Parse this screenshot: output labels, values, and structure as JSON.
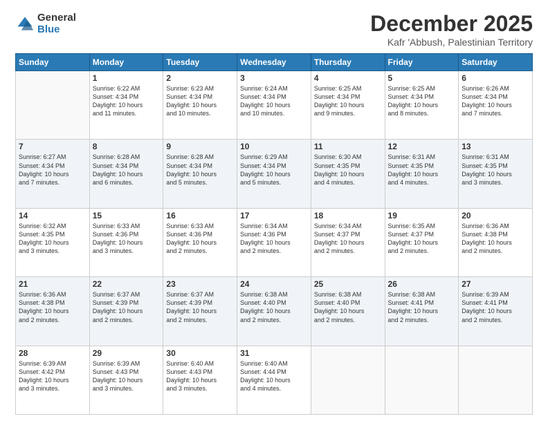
{
  "logo": {
    "general": "General",
    "blue": "Blue"
  },
  "header": {
    "month": "December 2025",
    "location": "Kafr 'Abbush, Palestinian Territory"
  },
  "days_of_week": [
    "Sunday",
    "Monday",
    "Tuesday",
    "Wednesday",
    "Thursday",
    "Friday",
    "Saturday"
  ],
  "weeks": [
    [
      {
        "num": "",
        "info": ""
      },
      {
        "num": "1",
        "info": "Sunrise: 6:22 AM\nSunset: 4:34 PM\nDaylight: 10 hours\nand 11 minutes."
      },
      {
        "num": "2",
        "info": "Sunrise: 6:23 AM\nSunset: 4:34 PM\nDaylight: 10 hours\nand 10 minutes."
      },
      {
        "num": "3",
        "info": "Sunrise: 6:24 AM\nSunset: 4:34 PM\nDaylight: 10 hours\nand 10 minutes."
      },
      {
        "num": "4",
        "info": "Sunrise: 6:25 AM\nSunset: 4:34 PM\nDaylight: 10 hours\nand 9 minutes."
      },
      {
        "num": "5",
        "info": "Sunrise: 6:25 AM\nSunset: 4:34 PM\nDaylight: 10 hours\nand 8 minutes."
      },
      {
        "num": "6",
        "info": "Sunrise: 6:26 AM\nSunset: 4:34 PM\nDaylight: 10 hours\nand 7 minutes."
      }
    ],
    [
      {
        "num": "7",
        "info": "Sunrise: 6:27 AM\nSunset: 4:34 PM\nDaylight: 10 hours\nand 7 minutes."
      },
      {
        "num": "8",
        "info": "Sunrise: 6:28 AM\nSunset: 4:34 PM\nDaylight: 10 hours\nand 6 minutes."
      },
      {
        "num": "9",
        "info": "Sunrise: 6:28 AM\nSunset: 4:34 PM\nDaylight: 10 hours\nand 5 minutes."
      },
      {
        "num": "10",
        "info": "Sunrise: 6:29 AM\nSunset: 4:34 PM\nDaylight: 10 hours\nand 5 minutes."
      },
      {
        "num": "11",
        "info": "Sunrise: 6:30 AM\nSunset: 4:35 PM\nDaylight: 10 hours\nand 4 minutes."
      },
      {
        "num": "12",
        "info": "Sunrise: 6:31 AM\nSunset: 4:35 PM\nDaylight: 10 hours\nand 4 minutes."
      },
      {
        "num": "13",
        "info": "Sunrise: 6:31 AM\nSunset: 4:35 PM\nDaylight: 10 hours\nand 3 minutes."
      }
    ],
    [
      {
        "num": "14",
        "info": "Sunrise: 6:32 AM\nSunset: 4:35 PM\nDaylight: 10 hours\nand 3 minutes."
      },
      {
        "num": "15",
        "info": "Sunrise: 6:33 AM\nSunset: 4:36 PM\nDaylight: 10 hours\nand 3 minutes."
      },
      {
        "num": "16",
        "info": "Sunrise: 6:33 AM\nSunset: 4:36 PM\nDaylight: 10 hours\nand 2 minutes."
      },
      {
        "num": "17",
        "info": "Sunrise: 6:34 AM\nSunset: 4:36 PM\nDaylight: 10 hours\nand 2 minutes."
      },
      {
        "num": "18",
        "info": "Sunrise: 6:34 AM\nSunset: 4:37 PM\nDaylight: 10 hours\nand 2 minutes."
      },
      {
        "num": "19",
        "info": "Sunrise: 6:35 AM\nSunset: 4:37 PM\nDaylight: 10 hours\nand 2 minutes."
      },
      {
        "num": "20",
        "info": "Sunrise: 6:36 AM\nSunset: 4:38 PM\nDaylight: 10 hours\nand 2 minutes."
      }
    ],
    [
      {
        "num": "21",
        "info": "Sunrise: 6:36 AM\nSunset: 4:38 PM\nDaylight: 10 hours\nand 2 minutes."
      },
      {
        "num": "22",
        "info": "Sunrise: 6:37 AM\nSunset: 4:39 PM\nDaylight: 10 hours\nand 2 minutes."
      },
      {
        "num": "23",
        "info": "Sunrise: 6:37 AM\nSunset: 4:39 PM\nDaylight: 10 hours\nand 2 minutes."
      },
      {
        "num": "24",
        "info": "Sunrise: 6:38 AM\nSunset: 4:40 PM\nDaylight: 10 hours\nand 2 minutes."
      },
      {
        "num": "25",
        "info": "Sunrise: 6:38 AM\nSunset: 4:40 PM\nDaylight: 10 hours\nand 2 minutes."
      },
      {
        "num": "26",
        "info": "Sunrise: 6:38 AM\nSunset: 4:41 PM\nDaylight: 10 hours\nand 2 minutes."
      },
      {
        "num": "27",
        "info": "Sunrise: 6:39 AM\nSunset: 4:41 PM\nDaylight: 10 hours\nand 2 minutes."
      }
    ],
    [
      {
        "num": "28",
        "info": "Sunrise: 6:39 AM\nSunset: 4:42 PM\nDaylight: 10 hours\nand 3 minutes."
      },
      {
        "num": "29",
        "info": "Sunrise: 6:39 AM\nSunset: 4:43 PM\nDaylight: 10 hours\nand 3 minutes."
      },
      {
        "num": "30",
        "info": "Sunrise: 6:40 AM\nSunset: 4:43 PM\nDaylight: 10 hours\nand 3 minutes."
      },
      {
        "num": "31",
        "info": "Sunrise: 6:40 AM\nSunset: 4:44 PM\nDaylight: 10 hours\nand 4 minutes."
      },
      {
        "num": "",
        "info": ""
      },
      {
        "num": "",
        "info": ""
      },
      {
        "num": "",
        "info": ""
      }
    ]
  ]
}
